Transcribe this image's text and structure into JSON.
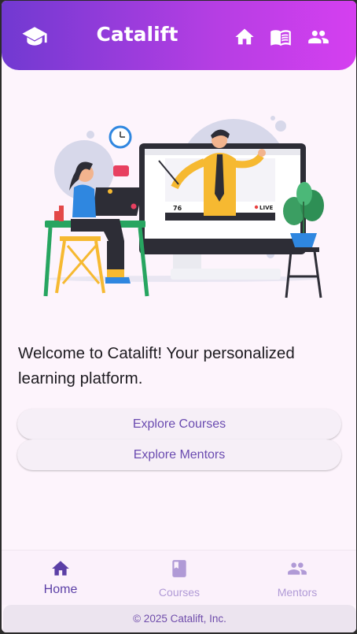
{
  "appbar": {
    "title": "Catalift",
    "logo_icon": "graduation-cap-icon",
    "actions": [
      {
        "icon": "home-icon"
      },
      {
        "icon": "book-open-icon"
      },
      {
        "icon": "people-icon"
      }
    ],
    "gradient": [
      "#7139d1",
      "#d53ff0"
    ]
  },
  "main": {
    "welcome_text": "Welcome to Catalift! Your personalized learning platform.",
    "hero_illustration": {
      "viewers_count": "76",
      "live_label": "LIVE"
    },
    "buttons": {
      "explore_courses": "Explore Courses",
      "explore_mentors": "Explore Mentors"
    }
  },
  "bottom_nav": {
    "items": [
      {
        "label": "Home",
        "icon": "home-icon",
        "active": true
      },
      {
        "label": "Courses",
        "icon": "book-icon",
        "active": false
      },
      {
        "label": "Mentors",
        "icon": "people-icon",
        "active": false
      }
    ],
    "active_color": "#5b3fa6",
    "inactive_color": "#b09ad6"
  },
  "footer": {
    "text": "© 2025 Catalift, Inc."
  }
}
